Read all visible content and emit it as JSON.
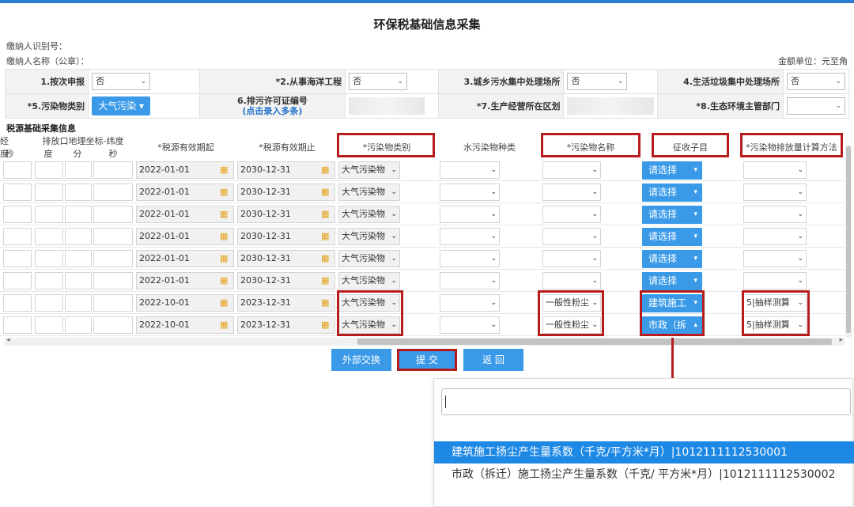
{
  "title": "环保税基础信息采集",
  "meta": {
    "taxpayer_id_label": "缴纳人识别号：",
    "taxpayer_name_label": "缴纳人名称（公章）：",
    "currency_unit": "金额单位：元至角"
  },
  "form": {
    "f1_label": "1.按次申报",
    "f1_value": "否",
    "f2_label": "*2.从事海洋工程",
    "f2_value": "否",
    "f3_label": "3.城乡污水集中处理场所",
    "f3_value": "否",
    "f4_label": "4.生活垃圾集中处理场所",
    "f4_value": "否",
    "f5_label": "*5.污染物类别",
    "f5_value": "大气污染",
    "f6_label": "6.排污许可证编号",
    "f6_sub": "(点击录入多条)",
    "f7_label": "*7.生产经营所在区划",
    "f8_label": "*8.生态环境主管部门"
  },
  "section_title": "税源基础采集信息",
  "headers": {
    "coord_group": "排放口地理坐标-纬度",
    "deg_partial": "经度",
    "sec_partial": "秒",
    "deg": "度",
    "min": "分",
    "sec": "秒",
    "start": "*税源有效期起",
    "end": "*税源有效期止",
    "pollutant_type": "*污染物类别",
    "water_kind": "水污染物种类",
    "pollutant_name": "*污染物名称",
    "subitem": "征收子目",
    "calc_method": "*污染物排放量计算方法"
  },
  "rows": [
    {
      "start": "2022-01-01",
      "end": "2030-12-31",
      "ptype": "大气污染物",
      "pname": "",
      "sub": "请选择",
      "method": ""
    },
    {
      "start": "2022-01-01",
      "end": "2030-12-31",
      "ptype": "大气污染物",
      "pname": "",
      "sub": "请选择",
      "method": ""
    },
    {
      "start": "2022-01-01",
      "end": "2030-12-31",
      "ptype": "大气污染物",
      "pname": "",
      "sub": "请选择",
      "method": ""
    },
    {
      "start": "2022-01-01",
      "end": "2030-12-31",
      "ptype": "大气污染物",
      "pname": "",
      "sub": "请选择",
      "method": ""
    },
    {
      "start": "2022-01-01",
      "end": "2030-12-31",
      "ptype": "大气污染物",
      "pname": "",
      "sub": "请选择",
      "method": ""
    },
    {
      "start": "2022-01-01",
      "end": "2030-12-31",
      "ptype": "大气污染物",
      "pname": "",
      "sub": "请选择",
      "method": ""
    },
    {
      "start": "2022-10-01",
      "end": "2023-12-31",
      "ptype": "大气污染物",
      "pname": "一般性粉尘",
      "sub": "建筑施工",
      "method": "5|抽样测算"
    },
    {
      "start": "2022-10-01",
      "end": "2023-12-31",
      "ptype": "大气污染物",
      "pname": "一般性粉尘",
      "sub": "市政（拆",
      "method": "5|抽样测算"
    }
  ],
  "buttons": {
    "external": "外部交换",
    "submit": "提 交",
    "back": "返 回"
  },
  "dropdown": {
    "options": [
      "建筑施工扬尘产生量系数（千克/平方米*月）|1012111112530001",
      "市政（拆迁）施工扬尘产生量系数（千克/ 平方米*月）|1012111112530002"
    ]
  }
}
